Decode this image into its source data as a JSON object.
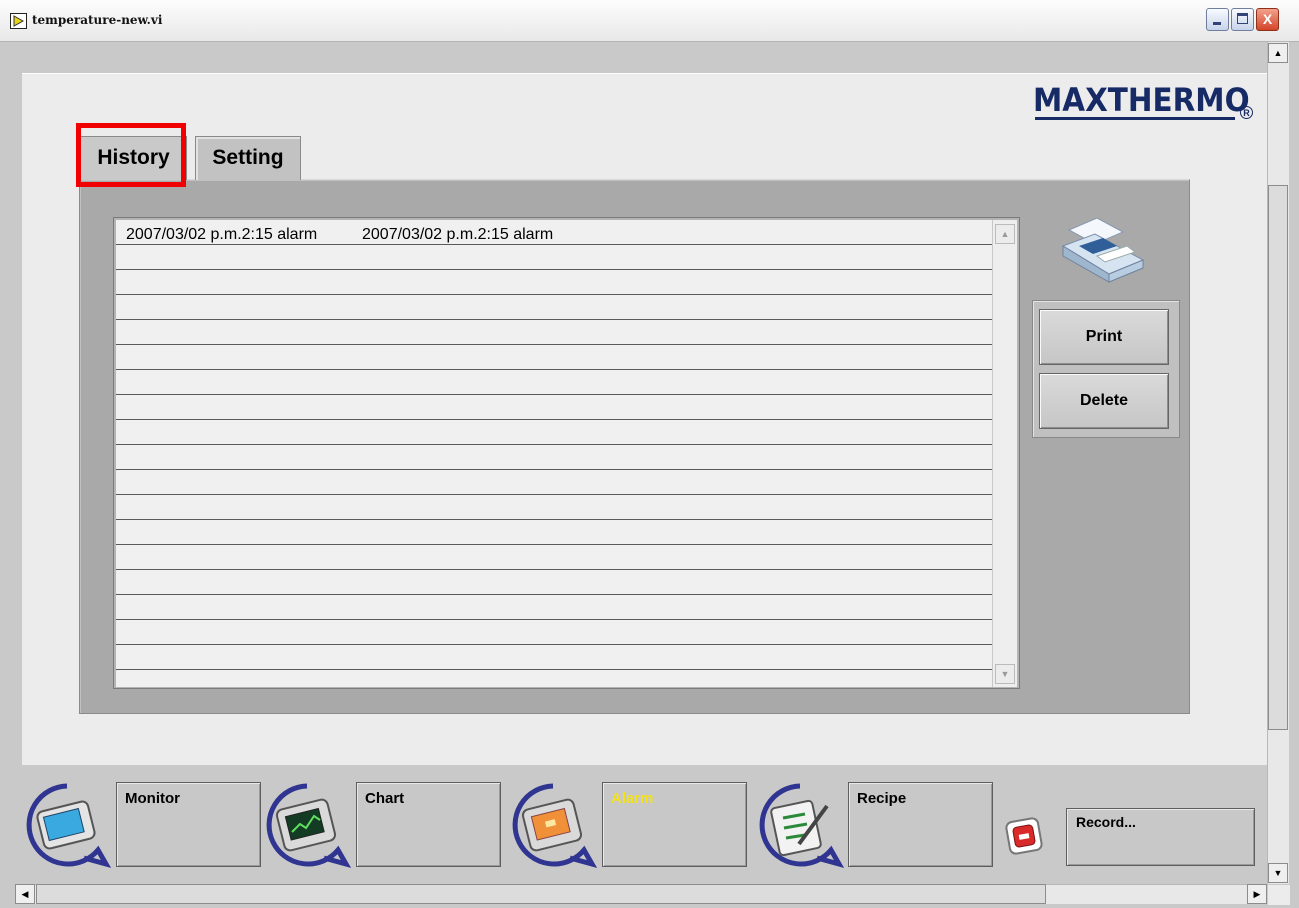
{
  "window": {
    "title": "temperature-new.vi",
    "minimize": "_",
    "maximize": "□",
    "close": "X"
  },
  "brand": {
    "logo": "MAXTHERMO",
    "registered": "R"
  },
  "tabs": [
    {
      "label": "History",
      "selected": true
    },
    {
      "label": "Setting",
      "selected": false
    }
  ],
  "history": {
    "rows": [
      {
        "col1": "2007/03/02 p.m.2:15 alarm",
        "col2": "2007/03/02 p.m.2:15 alarm"
      },
      {
        "col1": "",
        "col2": ""
      },
      {
        "col1": "",
        "col2": ""
      },
      {
        "col1": "",
        "col2": ""
      },
      {
        "col1": "",
        "col2": ""
      },
      {
        "col1": "",
        "col2": ""
      },
      {
        "col1": "",
        "col2": ""
      },
      {
        "col1": "",
        "col2": ""
      },
      {
        "col1": "",
        "col2": ""
      },
      {
        "col1": "",
        "col2": ""
      },
      {
        "col1": "",
        "col2": ""
      },
      {
        "col1": "",
        "col2": ""
      },
      {
        "col1": "",
        "col2": ""
      },
      {
        "col1": "",
        "col2": ""
      },
      {
        "col1": "",
        "col2": ""
      },
      {
        "col1": "",
        "col2": ""
      },
      {
        "col1": "",
        "col2": ""
      },
      {
        "col1": "",
        "col2": ""
      },
      {
        "col1": "",
        "col2": ""
      }
    ]
  },
  "actions": {
    "print_label": "Print",
    "delete_label": "Delete"
  },
  "nav": {
    "monitor": "Monitor",
    "chart": "Chart",
    "alarm": "Alarm",
    "recipe": "Recipe",
    "record": "Record..."
  },
  "scroll": {
    "up": "▲",
    "down": "▼",
    "left": "◀",
    "right": "▶"
  },
  "colors": {
    "highlight": "#f00000",
    "logo": "#162a66",
    "alarm_label": "#f3e21a",
    "icon_ring": "#2f3590"
  }
}
